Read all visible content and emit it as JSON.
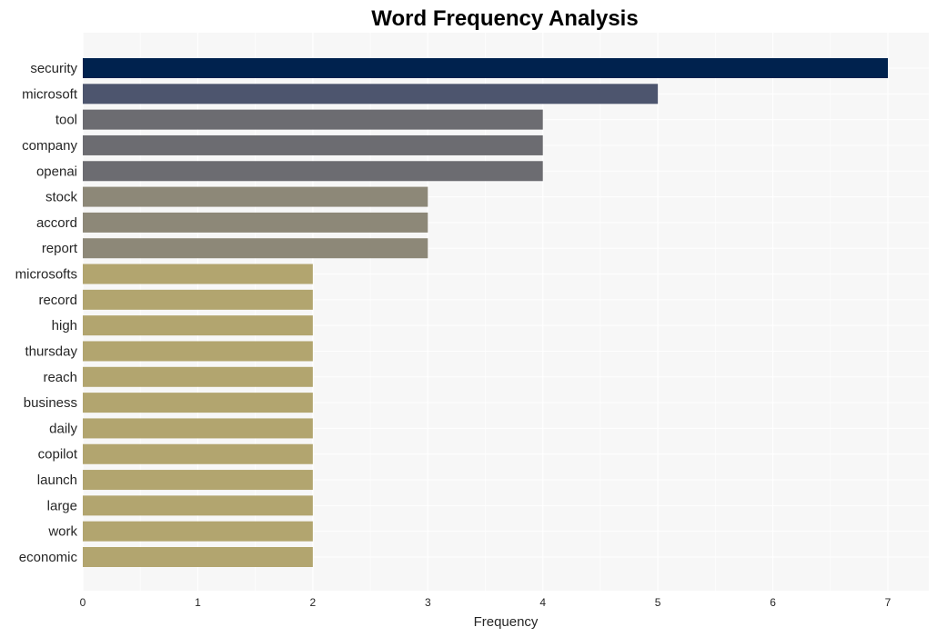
{
  "chart_data": {
    "type": "bar",
    "orientation": "horizontal",
    "title": "Word Frequency Analysis",
    "xlabel": "Frequency",
    "ylabel": "",
    "xlim": [
      0,
      7.35
    ],
    "xticks": [
      0,
      1,
      2,
      3,
      4,
      5,
      6,
      7
    ],
    "grid": true,
    "legend": "none",
    "categories": [
      "security",
      "microsoft",
      "tool",
      "company",
      "openai",
      "stock",
      "accord",
      "report",
      "microsofts",
      "record",
      "high",
      "thursday",
      "reach",
      "business",
      "daily",
      "copilot",
      "launch",
      "large",
      "work",
      "economic"
    ],
    "values": [
      7,
      5,
      4,
      4,
      4,
      3,
      3,
      3,
      2,
      2,
      2,
      2,
      2,
      2,
      2,
      2,
      2,
      2,
      2,
      2
    ],
    "colors_by_value": {
      "7": "#00224e",
      "5": "#4d556e",
      "4": "#6c6c71",
      "3": "#8d8878",
      "2": "#b2a56f"
    },
    "background": "#f7f7f7",
    "grid_color": "#ffffff"
  }
}
